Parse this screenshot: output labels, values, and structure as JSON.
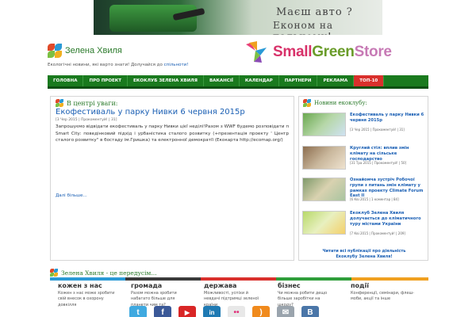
{
  "banner": {
    "line1": "Маєш авто ?",
    "line2": "Економ на пальному!"
  },
  "site": {
    "name": "Зелена Хвиля",
    "tagline_text": "Екологічні новини, які варто знати! Долучайся до ",
    "tagline_link": "спільноти!"
  },
  "store": {
    "part1": "Small",
    "part2": "Green",
    "part3": "Store"
  },
  "nav": {
    "items": [
      "ГОЛОВНА",
      "ПРО ПРОЕКТ",
      "ЕКОКЛУБ ЗЕЛЕНА ХВИЛЯ",
      "ВАКАНСІЇ",
      "КАЛЕНДАР",
      "ПАРТНЕРИ",
      "РЕКЛАМА",
      "ТОП-10"
    ]
  },
  "featured": {
    "section_title": "В центрі уваги:",
    "title": "Екофестиваль у парку Нивки 6 червня 2015р",
    "meta": "[3 Чер 2015 | Прокоментуй! | 31]",
    "text": "Запрошуємо відвідати екофестиваль у парку Нивки цієї неділі!Разом з WWF будемо розповідати п Smart City: поведінковий підхід і урбаністика сталого розвитку (+презентація проекту ' Центр сталого розвитку\" в бостаду ім.Гришка) та електронної демократії (Екокарта http://ecomap.org/)",
    "more": "Далі більше..."
  },
  "side": {
    "title": "Новини екоклубу:",
    "news": [
      {
        "title": "Екофестиваль у парку Нивки 6 червня 2015р",
        "meta": "[3 Чер 2015 | Прокоментуй! | 31]"
      },
      {
        "title": "Круглий стіл: вплив змін клімату на сільське господарство",
        "meta": "[31 Тра 2015 | Прокоментуй! | 50]"
      },
      {
        "title": "Ознайомча зустріч Робочої групи з питань змін клімату у рамках проекту Climate Forum East II",
        "meta": "[6 Кві 2015 | 1 коментар | 84]"
      },
      {
        "title": "Екоклуб Зелена Хвиля долучається до кліматичного туру містами України",
        "meta": "[7 Кві 2015 | Прокоментуй! | 209]"
      }
    ],
    "footer_line1": "Читати всі публікації про діяльність",
    "footer_line2": "Екоклубу Зелена Хвиля!"
  },
  "lower": {
    "title": "Зелена Хвиля - це передусім...",
    "columns": [
      {
        "title": "кожен з нас",
        "text": "Кожен з нас може зробити свій внесок в охорону довкілля",
        "color": "#2a9ad6"
      },
      {
        "title": "громада",
        "text": "Разом можна зробити набагато більше для планети чим та?",
        "color": "#3a3a3a"
      },
      {
        "title": "держава",
        "text": "Можливості, успіхи й невдачі підтримці зеленої країни",
        "color": "#d9302c"
      },
      {
        "title": "бізнес",
        "text": "Чи можна робити дещо більше заробітки на шкоду?",
        "color": "#2f9e3a"
      },
      {
        "title": "події",
        "text": "Конференції, семінари, флеш-моби, акції та інше",
        "color": "#f0a020"
      }
    ]
  },
  "socials": [
    {
      "icon": "twitter-icon",
      "glyph": "t",
      "color": "#3fa9e0"
    },
    {
      "icon": "facebook-icon",
      "glyph": "f",
      "color": "#3b5998"
    },
    {
      "icon": "youtube-icon",
      "glyph": "▶",
      "color": "#d92626"
    },
    {
      "icon": "linkedin-icon",
      "glyph": "in",
      "color": "#1f7ab3"
    },
    {
      "icon": "flickr-icon",
      "glyph": "••",
      "color": "#e8e8e8"
    },
    {
      "icon": "rss-icon",
      "glyph": ")",
      "color": "#f08a1c"
    },
    {
      "icon": "mail-icon",
      "glyph": "✉",
      "color": "#9aa4ad"
    },
    {
      "icon": "vk-icon",
      "glyph": "В",
      "color": "#4a76a8"
    }
  ]
}
